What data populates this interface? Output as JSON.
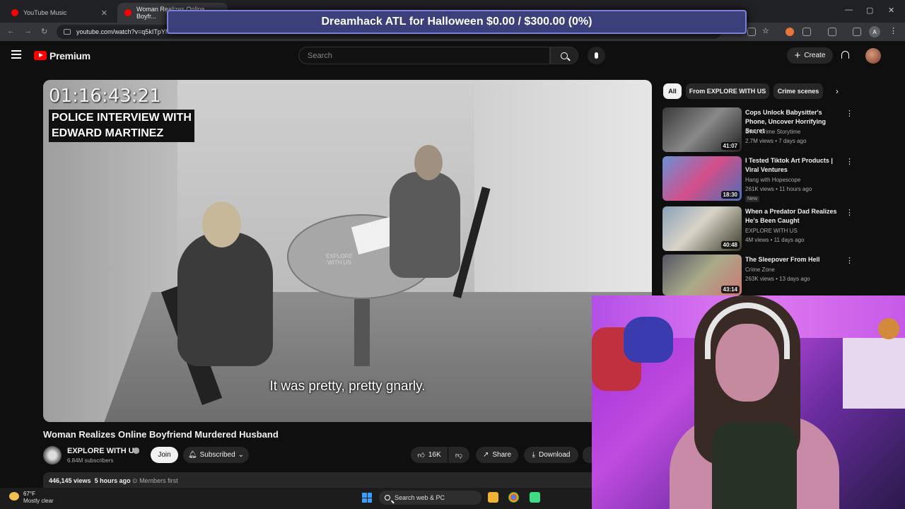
{
  "browser": {
    "tabs": [
      {
        "title": "YouTube Music"
      },
      {
        "title": "Woman Realizes Online Boyfr..."
      }
    ],
    "url": "youtube.com/watch?v=q5kITpYM",
    "profile_initial": "A"
  },
  "overlay": {
    "banner": "Dreamhack ATL for Halloween $0.00 / $300.00 (0%)"
  },
  "header": {
    "brand": "Premium",
    "search_placeholder": "Search",
    "create_label": "Create"
  },
  "player": {
    "timestamp": "01:16:43:21",
    "overlay_title_line1": "POLICE INTERVIEW WITH",
    "overlay_title_line2": "EDWARD MARTINEZ",
    "watermark_line1": "EXPLORE",
    "watermark_line2": "WITH US",
    "subtitle": "It was pretty, pretty gnarly."
  },
  "video": {
    "title": "Woman Realizes Online Boyfriend Murdered Husband",
    "channel": "EXPLORE WITH US",
    "subscribers": "6.84M subscribers",
    "join_label": "Join",
    "subscribed_label": "Subscribed",
    "likes": "16K",
    "share_label": "Share",
    "download_label": "Download",
    "views": "446,145 views",
    "age": "5 hours ago",
    "members": "Members first"
  },
  "sidebar": {
    "chips": [
      "All",
      "From EXPLORE WITH US",
      "Crime scenes"
    ],
    "recommendations": [
      {
        "title": "Cops Unlock Babysitter's Phone, Uncover Horrifying Secret",
        "channel": "EWU Crime Storytime",
        "meta": "2.7M views • 7 days ago",
        "duration": "41:07",
        "badge": ""
      },
      {
        "title": "I Tested Tiktok Art Products | Viral Ventures",
        "channel": "Hang with Hopescope",
        "meta": "261K views • 11 hours ago",
        "duration": "18:30",
        "badge": "New"
      },
      {
        "title": "When a Predator Dad Realizes He's Been Caught",
        "channel": "EXPLORE WITH US",
        "meta": "4M views • 11 days ago",
        "duration": "40:48",
        "badge": ""
      },
      {
        "title": "The Sleepover From Hell",
        "channel": "Crime Zone",
        "meta": "263K views • 13 days ago",
        "duration": "43:14",
        "badge": ""
      }
    ]
  },
  "taskbar": {
    "temperature": "67°F",
    "weather": "Mostly clear",
    "search_label": "Search web & PC"
  }
}
